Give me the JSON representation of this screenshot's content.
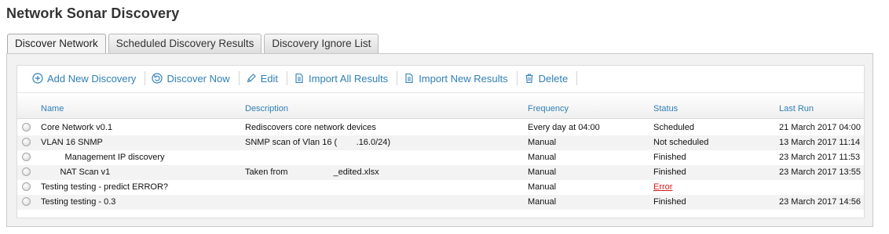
{
  "page": {
    "title": "Network Sonar Discovery"
  },
  "tabs": [
    {
      "label": "Discover Network",
      "active": true
    },
    {
      "label": "Scheduled Discovery Results",
      "active": false
    },
    {
      "label": "Discovery Ignore List",
      "active": false
    }
  ],
  "toolbar": {
    "add_new_discovery": "Add New Discovery",
    "discover_now": "Discover Now",
    "edit": "Edit",
    "import_all_results": "Import All Results",
    "import_new_results": "Import New Results",
    "delete": "Delete"
  },
  "table": {
    "headers": {
      "name": "Name",
      "description": "Description",
      "frequency": "Frequency",
      "status": "Status",
      "last_run": "Last Run"
    },
    "rows": [
      {
        "name": "Core Network v0.1",
        "description": "Rediscovers core network devices",
        "frequency": "Every day at 04:00",
        "status": "Scheduled",
        "last_run": "21 March 2017 04:00"
      },
      {
        "name": "VLAN 16 SNMP",
        "description": "SNMP scan of Vlan 16 (        .16.0/24)",
        "frequency": "Manual",
        "status": "Not scheduled",
        "last_run": "13 March 2017 11:14"
      },
      {
        "name": "          Management IP discovery",
        "description": "",
        "frequency": "Manual",
        "status": "Finished",
        "last_run": "23 March 2017 11:53"
      },
      {
        "name": "        NAT Scan v1",
        "description": "Taken from                   _edited.xlsx",
        "frequency": "Manual",
        "status": "Finished",
        "last_run": "23 March 2017 13:55"
      },
      {
        "name": "Testing testing - predict ERROR?",
        "description": "",
        "frequency": "Manual",
        "status": "Error",
        "last_run": ""
      },
      {
        "name": "Testing testing - 0.3",
        "description": "",
        "frequency": "Manual",
        "status": "Finished",
        "last_run": "23 March 2017 14:56"
      }
    ]
  },
  "colors": {
    "link": "#2f7fb5",
    "error": "#d21a1a",
    "title": "#333333"
  },
  "icons": [
    "add-icon",
    "discover-now-icon",
    "edit-icon",
    "import-all-icon",
    "import-new-icon",
    "delete-icon"
  ]
}
